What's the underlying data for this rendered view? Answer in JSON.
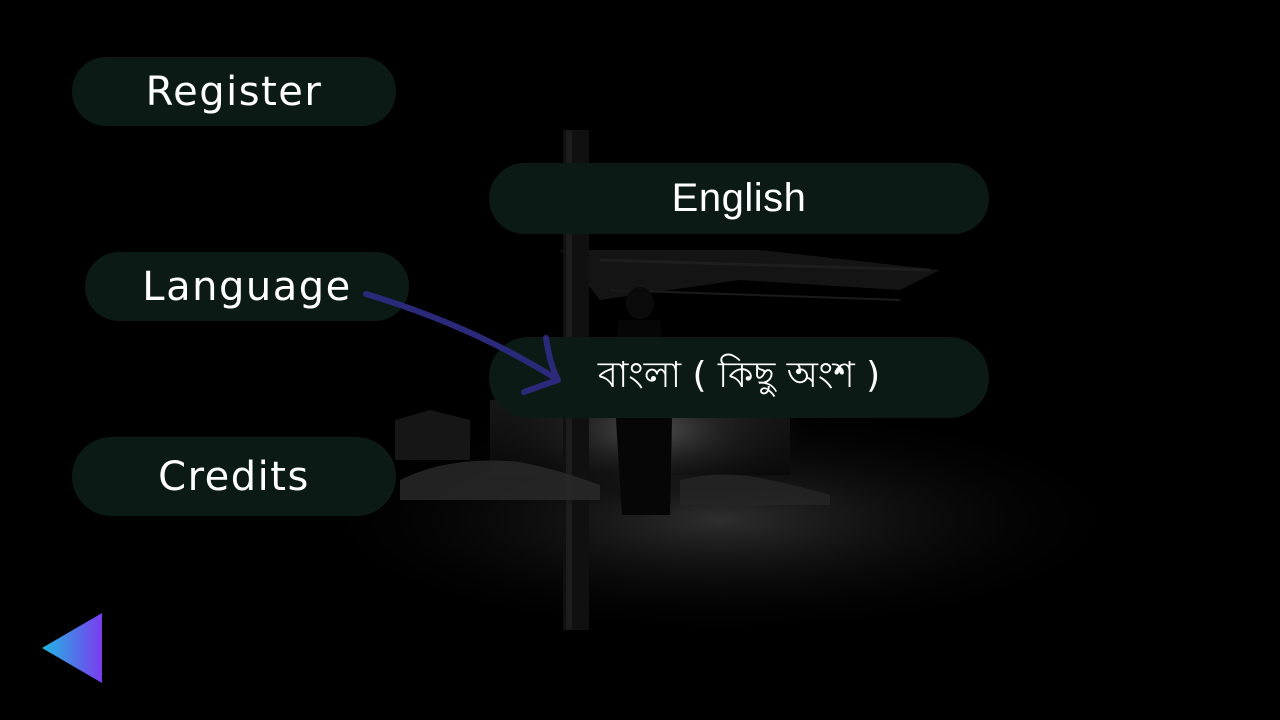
{
  "menu": {
    "register_label": "Register",
    "language_label": "Language",
    "credits_label": "Credits"
  },
  "language_options": {
    "english_label": "English",
    "bangla_label": "বাংলা ( কিছু অংশ )"
  },
  "navigation": {
    "back_icon": "triangle-left-back-icon"
  },
  "colors": {
    "button_bg": "#0b1a15",
    "button_text": "#ffffff",
    "arrow": "#2b2a7a",
    "back_gradient_start": "#1fb8e0",
    "back_gradient_end": "#7b3cf0"
  }
}
